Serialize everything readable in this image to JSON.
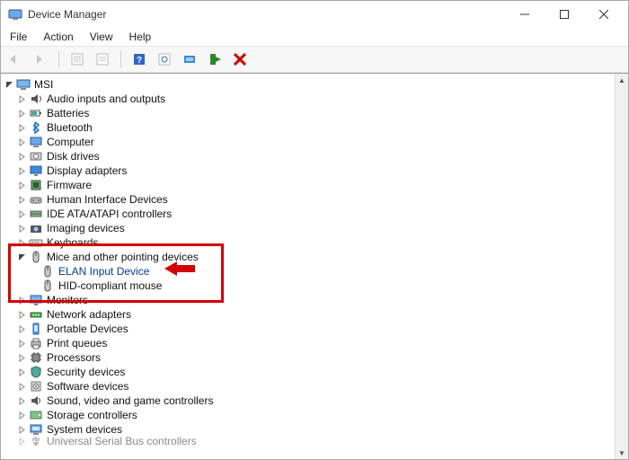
{
  "window": {
    "title": "Device Manager"
  },
  "menu": {
    "file": "File",
    "action": "Action",
    "view": "View",
    "help": "Help"
  },
  "root": {
    "name": "MSI"
  },
  "categories": [
    {
      "label": "Audio inputs and outputs",
      "icon": "audio-icon"
    },
    {
      "label": "Batteries",
      "icon": "battery-icon"
    },
    {
      "label": "Bluetooth",
      "icon": "bluetooth-icon"
    },
    {
      "label": "Computer",
      "icon": "computer-icon"
    },
    {
      "label": "Disk drives",
      "icon": "disk-icon"
    },
    {
      "label": "Display adapters",
      "icon": "display-icon"
    },
    {
      "label": "Firmware",
      "icon": "firmware-icon"
    },
    {
      "label": "Human Interface Devices",
      "icon": "hid-icon"
    },
    {
      "label": "IDE ATA/ATAPI controllers",
      "icon": "ide-icon"
    },
    {
      "label": "Imaging devices",
      "icon": "imaging-icon"
    },
    {
      "label": "Keyboards",
      "icon": "keyboard-icon"
    },
    {
      "label": "Mice and other pointing devices",
      "icon": "mouse-icon",
      "expanded": true,
      "children": [
        {
          "label": "ELAN Input Device",
          "hl": true
        },
        {
          "label": "HID-compliant mouse"
        }
      ]
    },
    {
      "label": "Monitors",
      "icon": "monitor-icon"
    },
    {
      "label": "Network adapters",
      "icon": "network-icon"
    },
    {
      "label": "Portable Devices",
      "icon": "portable-icon"
    },
    {
      "label": "Print queues",
      "icon": "printer-icon"
    },
    {
      "label": "Processors",
      "icon": "cpu-icon"
    },
    {
      "label": "Security devices",
      "icon": "security-icon"
    },
    {
      "label": "Software devices",
      "icon": "software-icon"
    },
    {
      "label": "Sound, video and game controllers",
      "icon": "sound-icon"
    },
    {
      "label": "Storage controllers",
      "icon": "storage-icon"
    },
    {
      "label": "System devices",
      "icon": "system-icon"
    },
    {
      "label": "Universal Serial Bus controllers",
      "icon": "usb-icon",
      "cut": true
    }
  ]
}
